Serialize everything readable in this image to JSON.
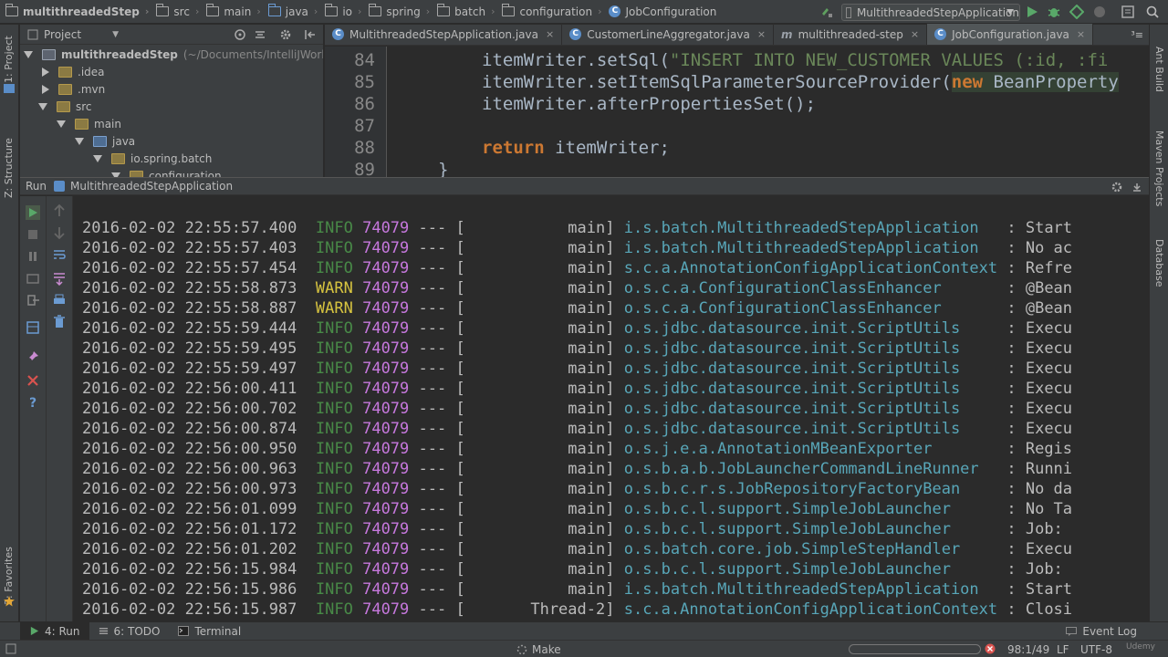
{
  "breadcrumbs": [
    "multithreadedStep",
    "src",
    "main",
    "java",
    "io",
    "spring",
    "batch",
    "configuration",
    "JobConfiguration"
  ],
  "toolbar": {
    "run_config": "MultithreadedStepApplication"
  },
  "left_strip": {
    "project": "1: Project",
    "structure": "Z: Structure",
    "favorites": "2: Favorites"
  },
  "right_strip": {
    "ant": "Ant Build",
    "maven": "Maven Projects",
    "database": "Database"
  },
  "project_panel": {
    "header": "Project",
    "root_name": "multithreadedStep",
    "root_path": "(~/Documents/IntelliJWorkspace",
    "items": [
      ".idea",
      ".mvn",
      "src",
      "main",
      "java",
      "io.spring.batch",
      "configuration"
    ]
  },
  "editor_tabs": [
    {
      "label": "MultithreadedStepApplication.java",
      "icon": "C"
    },
    {
      "label": "CustomerLineAggregator.java",
      "icon": "C"
    },
    {
      "label": "multithreaded-step",
      "icon": "m"
    },
    {
      "label": "JobConfiguration.java",
      "icon": "C"
    }
  ],
  "editor_tab_overflow": "³≡",
  "editor": {
    "line_numbers": [
      "84",
      "85",
      "86",
      "87",
      "88",
      "89"
    ],
    "lines": {
      "l84_a": "itemWriter.setSql(",
      "l84_b": "\"INSERT INTO NEW_CUSTOMER VALUES (:id, :fi",
      "l85_a": "itemWriter.setItemSqlParameterSourceProvider(",
      "l85_kw": "new",
      "l85_b": " BeanProperty",
      "l86": "itemWriter.afterPropertiesSet();",
      "l88_kw": "return",
      "l88_b": " itemWriter;",
      "l89": "}"
    }
  },
  "run_panel": {
    "label": "Run",
    "config": "MultithreadedStepApplication"
  },
  "console_lines": [
    {
      "ts": "2016-02-02 22:55:57.400",
      "level": "INFO",
      "pid": "74079",
      "thread": "main",
      "logger": "i.s.batch.MultithreadedStepApplication",
      "msg": ": Start"
    },
    {
      "ts": "2016-02-02 22:55:57.403",
      "level": "INFO",
      "pid": "74079",
      "thread": "main",
      "logger": "i.s.batch.MultithreadedStepApplication",
      "msg": ": No ac"
    },
    {
      "ts": "2016-02-02 22:55:57.454",
      "level": "INFO",
      "pid": "74079",
      "thread": "main",
      "logger": "s.c.a.AnnotationConfigApplicationContext",
      "msg": ": Refre"
    },
    {
      "ts": "2016-02-02 22:55:58.873",
      "level": "WARN",
      "pid": "74079",
      "thread": "main",
      "logger": "o.s.c.a.ConfigurationClassEnhancer",
      "msg": ": @Bean"
    },
    {
      "ts": "2016-02-02 22:55:58.887",
      "level": "WARN",
      "pid": "74079",
      "thread": "main",
      "logger": "o.s.c.a.ConfigurationClassEnhancer",
      "msg": ": @Bean"
    },
    {
      "ts": "2016-02-02 22:55:59.444",
      "level": "INFO",
      "pid": "74079",
      "thread": "main",
      "logger": "o.s.jdbc.datasource.init.ScriptUtils",
      "msg": ": Execu"
    },
    {
      "ts": "2016-02-02 22:55:59.495",
      "level": "INFO",
      "pid": "74079",
      "thread": "main",
      "logger": "o.s.jdbc.datasource.init.ScriptUtils",
      "msg": ": Execu"
    },
    {
      "ts": "2016-02-02 22:55:59.497",
      "level": "INFO",
      "pid": "74079",
      "thread": "main",
      "logger": "o.s.jdbc.datasource.init.ScriptUtils",
      "msg": ": Execu"
    },
    {
      "ts": "2016-02-02 22:56:00.411",
      "level": "INFO",
      "pid": "74079",
      "thread": "main",
      "logger": "o.s.jdbc.datasource.init.ScriptUtils",
      "msg": ": Execu"
    },
    {
      "ts": "2016-02-02 22:56:00.702",
      "level": "INFO",
      "pid": "74079",
      "thread": "main",
      "logger": "o.s.jdbc.datasource.init.ScriptUtils",
      "msg": ": Execu"
    },
    {
      "ts": "2016-02-02 22:56:00.874",
      "level": "INFO",
      "pid": "74079",
      "thread": "main",
      "logger": "o.s.jdbc.datasource.init.ScriptUtils",
      "msg": ": Execu"
    },
    {
      "ts": "2016-02-02 22:56:00.950",
      "level": "INFO",
      "pid": "74079",
      "thread": "main",
      "logger": "o.s.j.e.a.AnnotationMBeanExporter",
      "msg": ": Regis"
    },
    {
      "ts": "2016-02-02 22:56:00.963",
      "level": "INFO",
      "pid": "74079",
      "thread": "main",
      "logger": "o.s.b.a.b.JobLauncherCommandLineRunner",
      "msg": ": Runni"
    },
    {
      "ts": "2016-02-02 22:56:00.973",
      "level": "INFO",
      "pid": "74079",
      "thread": "main",
      "logger": "o.s.b.c.r.s.JobRepositoryFactoryBean",
      "msg": ": No da"
    },
    {
      "ts": "2016-02-02 22:56:01.099",
      "level": "INFO",
      "pid": "74079",
      "thread": "main",
      "logger": "o.s.b.c.l.support.SimpleJobLauncher",
      "msg": ": No Ta"
    },
    {
      "ts": "2016-02-02 22:56:01.172",
      "level": "INFO",
      "pid": "74079",
      "thread": "main",
      "logger": "o.s.b.c.l.support.SimpleJobLauncher",
      "msg": ": Job:"
    },
    {
      "ts": "2016-02-02 22:56:01.202",
      "level": "INFO",
      "pid": "74079",
      "thread": "main",
      "logger": "o.s.batch.core.job.SimpleStepHandler",
      "msg": ": Execu"
    },
    {
      "ts": "2016-02-02 22:56:15.984",
      "level": "INFO",
      "pid": "74079",
      "thread": "main",
      "logger": "o.s.b.c.l.support.SimpleJobLauncher",
      "msg": ": Job:"
    },
    {
      "ts": "2016-02-02 22:56:15.986",
      "level": "INFO",
      "pid": "74079",
      "thread": "main",
      "logger": "i.s.batch.MultithreadedStepApplication",
      "msg": ": Start"
    },
    {
      "ts": "2016-02-02 22:56:15.987",
      "level": "INFO",
      "pid": "74079",
      "thread": "Thread-2",
      "logger": "s.c.a.AnnotationConfigApplicationContext",
      "msg": ": Closi"
    }
  ],
  "bottom_tabs": {
    "run": "4: Run",
    "todo": "6: TODO",
    "terminal": "Terminal",
    "event_log": "Event Log"
  },
  "status_bar": {
    "make": "Make",
    "position": "98:1/49",
    "line_sep": "LF",
    "encoding": "UTF-8"
  },
  "watermark": "Udemy",
  "colors": {
    "info": "#50a14f",
    "warn": "#d6c340",
    "pid": "#c678dd",
    "logger": "#58a6b8",
    "keyword": "#cc7832",
    "string": "#6a8759"
  }
}
